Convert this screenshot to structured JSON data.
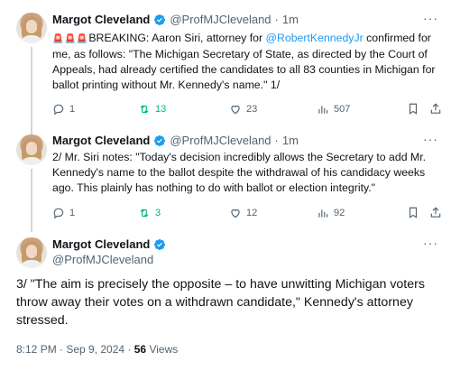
{
  "tweets": [
    {
      "author": "Margot Cleveland",
      "handle": "@ProfMJCleveland",
      "time": "1m",
      "prefix_emoji": "🚨🚨🚨",
      "text_1": "BREAKING: Aaron Siri, attorney for ",
      "mention": "@RobertKennedyJr",
      "text_2": " confirmed for me, as follows:  \"The Michigan Secretary of State, as directed by the Court of Appeals, had already certified the candidates to all 83 counties in Michigan for ballot printing without Mr. Kennedy's name.\" 1/",
      "replies": "1",
      "reposts": "13",
      "likes": "23",
      "views": "507"
    },
    {
      "author": "Margot Cleveland",
      "handle": "@ProfMJCleveland",
      "time": "1m",
      "text": "2/ Mr. Siri notes: \"Today's decision incredibly allows the Secretary to add Mr. Kennedy's name to the ballot despite the withdrawal of his candidacy weeks ago. This plainly has nothing to do with ballot or election integrity.\"",
      "replies": "1",
      "reposts": "3",
      "likes": "12",
      "views": "92"
    }
  ],
  "main_tweet": {
    "author": "Margot Cleveland",
    "handle": "@ProfMJCleveland",
    "text": "3/ \"The aim is precisely the opposite – to have unwitting Michigan voters throw away their votes on a withdrawn candidate,\" Kennedy's attorney stressed.",
    "timestamp": "8:12 PM · Sep 9, 2024 · ",
    "views_count": "56",
    "views_label": " Views"
  },
  "icons": {
    "verified": "verified-badge-icon",
    "reply": "reply-icon",
    "repost": "repost-icon",
    "like": "heart-icon",
    "views": "views-icon",
    "bookmark": "bookmark-icon",
    "more": "more-icon"
  },
  "colors": {
    "link": "#1d9bf0",
    "repost": "#00ba7c",
    "muted": "#536471",
    "verified": "#1d9bf0"
  }
}
